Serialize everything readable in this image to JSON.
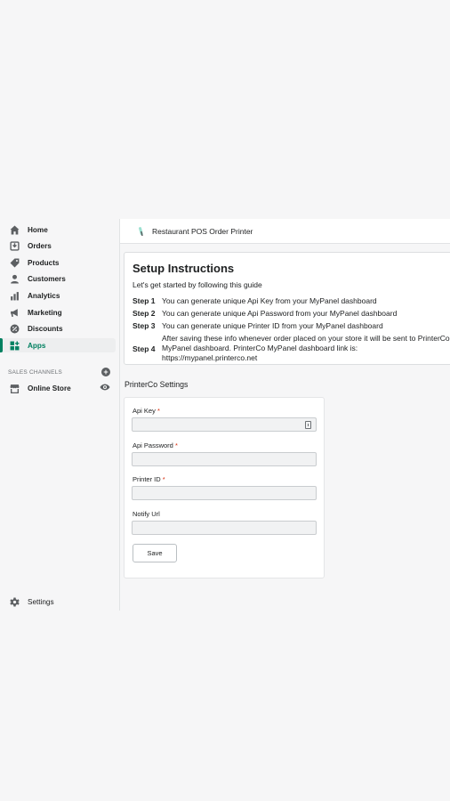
{
  "sidebar": {
    "items": [
      {
        "label": "Home",
        "icon": "home-icon"
      },
      {
        "label": "Orders",
        "icon": "orders-icon"
      },
      {
        "label": "Products",
        "icon": "tag-icon"
      },
      {
        "label": "Customers",
        "icon": "person-icon"
      },
      {
        "label": "Analytics",
        "icon": "bar-chart-icon"
      },
      {
        "label": "Marketing",
        "icon": "megaphone-icon"
      },
      {
        "label": "Discounts",
        "icon": "discount-icon"
      },
      {
        "label": "Apps",
        "icon": "apps-icon",
        "active": true
      }
    ],
    "sales_channels_heading": "SALES CHANNELS",
    "channels": [
      {
        "label": "Online Store",
        "icon": "store-icon"
      }
    ],
    "settings_label": "Settings"
  },
  "header": {
    "app_title": "Restaurant POS Order Printer"
  },
  "setup": {
    "title": "Setup Instructions",
    "subtitle": "Let's get started by following this guide",
    "steps": [
      {
        "label": "Step 1",
        "text": "You can generate unique Api Key from your MyPanel dashboard"
      },
      {
        "label": "Step 2",
        "text": "You can generate unique Api Password from your MyPanel dashboard"
      },
      {
        "label": "Step 3",
        "text": "You can generate unique Printer ID from your MyPanel dashboard"
      },
      {
        "label": "Step 4",
        "text": "After saving these info whenever order placed on your store it will be sent to PrinterCo MyPanel dashboard. PrinterCo MyPanel dashboard link is: https://mypanel.printerco.net"
      }
    ]
  },
  "settings": {
    "title": "PrinterCo Settings",
    "fields": [
      {
        "label": "Api Key",
        "required_mark": "*",
        "value": ""
      },
      {
        "label": "Api Password",
        "required_mark": "*",
        "value": ""
      },
      {
        "label": "Printer ID",
        "required_mark": "*",
        "value": ""
      },
      {
        "label": "Notify Url",
        "required_mark": "",
        "value": ""
      }
    ],
    "save_label": "Save"
  },
  "colors": {
    "accent": "#008060",
    "required": "#d72c0d",
    "background": "#f6f6f7"
  }
}
